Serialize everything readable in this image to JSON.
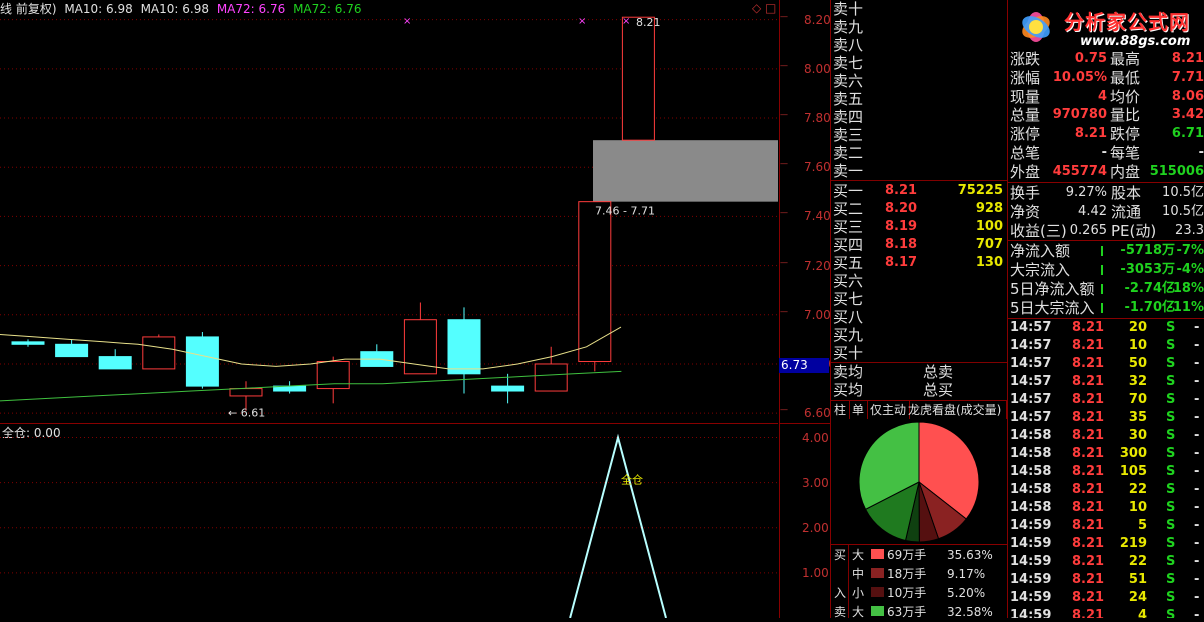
{
  "chart_header": {
    "title": "线 前复权)",
    "ma1": "MA10: 6.98",
    "ma2": "MA10: 6.98",
    "ma3": "MA72: 6.76",
    "ma4": "MA72: 6.76"
  },
  "colors": {
    "up": "#ff3c3c",
    "down": "#54ffff",
    "ma_short": "#e8e08a",
    "ma_long": "#3fc03f",
    "grid": "#800000"
  },
  "chart_data": [
    {
      "type": "candlestick",
      "y_ticks": [
        "8.20",
        "8.00",
        "7.80",
        "7.60",
        "7.40",
        "7.20",
        "7.00",
        "6.80",
        "6.60"
      ],
      "ylim": [
        6.56,
        8.28
      ],
      "candles": [
        {
          "o": 6.89,
          "h": 6.9,
          "l": 6.87,
          "c": 6.88
        },
        {
          "o": 6.88,
          "h": 6.9,
          "l": 6.83,
          "c": 6.83
        },
        {
          "o": 6.83,
          "h": 6.86,
          "l": 6.78,
          "c": 6.78
        },
        {
          "o": 6.78,
          "h": 6.92,
          "l": 6.78,
          "c": 6.91
        },
        {
          "o": 6.91,
          "h": 6.93,
          "l": 6.7,
          "c": 6.71
        },
        {
          "o": 6.67,
          "h": 6.73,
          "l": 6.61,
          "c": 6.7
        },
        {
          "o": 6.71,
          "h": 6.73,
          "l": 6.68,
          "c": 6.69
        },
        {
          "o": 6.7,
          "h": 6.83,
          "l": 6.64,
          "c": 6.81
        },
        {
          "o": 6.85,
          "h": 6.88,
          "l": 6.79,
          "c": 6.79
        },
        {
          "o": 6.76,
          "h": 7.05,
          "l": 6.76,
          "c": 6.98
        },
        {
          "o": 6.98,
          "h": 7.03,
          "l": 6.68,
          "c": 6.76
        },
        {
          "o": 6.71,
          "h": 6.76,
          "l": 6.64,
          "c": 6.69
        },
        {
          "o": 6.69,
          "h": 6.87,
          "l": 6.69,
          "c": 6.8
        },
        {
          "o": 6.81,
          "h": 6.87,
          "l": 6.77,
          "c": 7.46
        },
        {
          "o": 7.71,
          "h": 8.21,
          "l": 7.71,
          "c": 8.21
        }
      ],
      "ma10": [
        6.92,
        6.91,
        6.9,
        6.89,
        6.88,
        6.86,
        6.83,
        6.8,
        6.79,
        6.8,
        6.82,
        6.82,
        6.8,
        6.78,
        6.78,
        6.8,
        6.83,
        6.87,
        6.95
      ],
      "ma72": [
        6.65,
        6.66,
        6.67,
        6.68,
        6.69,
        6.7,
        6.71,
        6.72,
        6.72,
        6.73,
        6.74,
        6.75,
        6.76,
        6.77
      ],
      "annotations": {
        "low_label": "6.61",
        "high_label": "8.21",
        "gap_label": "7.46 - 7.71",
        "current_price": "6.73",
        "markers": [
          "×",
          "×",
          "×"
        ]
      }
    },
    {
      "type": "line",
      "title": "全仓: 0.00",
      "y_ticks": [
        "4.00",
        "3.00",
        "2.00",
        "1.00"
      ],
      "ylim": [
        0,
        4.3
      ],
      "x": [
        12.8,
        13.9,
        15.0
      ],
      "values": [
        0.0,
        4.0,
        0.0
      ],
      "annotation": "全仓"
    }
  ],
  "logo": {
    "title": "分析家公式网",
    "url": "www.88gs.com"
  },
  "sell_levels": [
    "卖十",
    "卖九",
    "卖八",
    "卖七",
    "卖六",
    "卖五",
    "卖四",
    "卖三",
    "卖二",
    "卖一"
  ],
  "buy_levels": [
    {
      "label": "买一",
      "price": "8.21",
      "vol": "75225"
    },
    {
      "label": "买二",
      "price": "8.20",
      "vol": "928"
    },
    {
      "label": "买三",
      "price": "8.19",
      "vol": "100"
    },
    {
      "label": "买四",
      "price": "8.18",
      "vol": "707"
    },
    {
      "label": "买五",
      "price": "8.17",
      "vol": "130"
    },
    {
      "label": "买六",
      "price": "",
      "vol": ""
    },
    {
      "label": "买七",
      "price": "",
      "vol": ""
    },
    {
      "label": "买八",
      "price": "",
      "vol": ""
    },
    {
      "label": "买九",
      "price": "",
      "vol": ""
    },
    {
      "label": "买十",
      "price": "",
      "vol": ""
    }
  ],
  "avg": {
    "sell_avg": "卖均",
    "sell_total": "总卖",
    "buy_avg": "买均",
    "buy_total": "总买"
  },
  "tabs": [
    "柱",
    "单",
    "仅主动",
    "龙虎看盘(成交量)历"
  ],
  "quote": [
    {
      "l1": "涨跌",
      "v1": "0.75",
      "l2": "最高",
      "v2": "8.21"
    },
    {
      "l1": "涨幅",
      "v1": "10.05%",
      "l2": "最低",
      "v2": "7.71"
    },
    {
      "l1": "现量",
      "v1": "4",
      "l2": "均价",
      "v2": "8.06"
    },
    {
      "l1": "总量",
      "v1": "970780",
      "l2": "量比",
      "v2": "3.42"
    },
    {
      "l1": "涨停",
      "v1": "8.21",
      "l2": "跌停",
      "v2": "6.71"
    },
    {
      "l1": "总笔",
      "v1": "-",
      "l2": "每笔",
      "v2": "-"
    },
    {
      "l1": "外盘",
      "v1": "455774",
      "l2": "内盘",
      "v2": "515006"
    }
  ],
  "finance": [
    {
      "l1": "换手",
      "v1": "9.27%",
      "l2": "股本",
      "v2": "10.5亿"
    },
    {
      "l1": "净资",
      "v1": "4.42",
      "l2": "流通",
      "v2": "10.5亿"
    },
    {
      "l1": "收益(三)",
      "v1": "0.265",
      "l2": "PE(动)",
      "v2": "23.3"
    }
  ],
  "flows": [
    {
      "label": "净流入额",
      "value": "-5718万",
      "pct": "-7%"
    },
    {
      "label": "大宗流入",
      "value": "-3053万",
      "pct": "-4%"
    },
    {
      "label": "5日净流入额",
      "value": "-2.74亿",
      "pct": "-18%"
    },
    {
      "label": "5日大宗流入",
      "value": "-1.70亿",
      "pct": "-11%"
    }
  ],
  "pie": {
    "slices": [
      {
        "name": "买大",
        "pct": 35.63,
        "color": "#ff5050"
      },
      {
        "name": "买中",
        "pct": 9.17,
        "color": "#8a2222"
      },
      {
        "name": "买小",
        "pct": 5.2,
        "color": "#551010"
      },
      {
        "name": "卖小",
        "pct": 3.7,
        "color": "#0f4010"
      },
      {
        "name": "卖中",
        "pct": 13.9,
        "color": "#1f7a1f"
      },
      {
        "name": "卖大",
        "pct": 32.58,
        "color": "#44c044"
      }
    ]
  },
  "pie_legend": [
    {
      "side": "买",
      "size": "大",
      "vol": "69万手",
      "pct": "35.63%",
      "color": "#ff5050"
    },
    {
      "side": "",
      "size": "中",
      "vol": "18万手",
      "pct": "9.17%",
      "color": "#8a2222"
    },
    {
      "side": "入",
      "size": "小",
      "vol": "10万手",
      "pct": "5.20%",
      "color": "#551010"
    },
    {
      "side": "卖",
      "size": "大",
      "vol": "63万手",
      "pct": "32.58%",
      "color": "#44c044"
    }
  ],
  "ticks": [
    {
      "time": "14:57",
      "price": "8.21",
      "vol": "20",
      "bs": "S",
      "sep": "-"
    },
    {
      "time": "14:57",
      "price": "8.21",
      "vol": "10",
      "bs": "S",
      "sep": "-"
    },
    {
      "time": "14:57",
      "price": "8.21",
      "vol": "50",
      "bs": "S",
      "sep": "-"
    },
    {
      "time": "14:57",
      "price": "8.21",
      "vol": "32",
      "bs": "S",
      "sep": "-"
    },
    {
      "time": "14:57",
      "price": "8.21",
      "vol": "70",
      "bs": "S",
      "sep": "-"
    },
    {
      "time": "14:57",
      "price": "8.21",
      "vol": "35",
      "bs": "S",
      "sep": "-"
    },
    {
      "time": "14:58",
      "price": "8.21",
      "vol": "30",
      "bs": "S",
      "sep": "-"
    },
    {
      "time": "14:58",
      "price": "8.21",
      "vol": "300",
      "bs": "S",
      "sep": "-"
    },
    {
      "time": "14:58",
      "price": "8.21",
      "vol": "105",
      "bs": "S",
      "sep": "-"
    },
    {
      "time": "14:58",
      "price": "8.21",
      "vol": "22",
      "bs": "S",
      "sep": "-"
    },
    {
      "time": "14:58",
      "price": "8.21",
      "vol": "10",
      "bs": "S",
      "sep": "-"
    },
    {
      "time": "14:59",
      "price": "8.21",
      "vol": "5",
      "bs": "S",
      "sep": "-"
    },
    {
      "time": "14:59",
      "price": "8.21",
      "vol": "219",
      "bs": "S",
      "sep": "-"
    },
    {
      "time": "14:59",
      "price": "8.21",
      "vol": "22",
      "bs": "S",
      "sep": "-"
    },
    {
      "time": "14:59",
      "price": "8.21",
      "vol": "51",
      "bs": "S",
      "sep": "-"
    },
    {
      "time": "14:59",
      "price": "8.21",
      "vol": "24",
      "bs": "S",
      "sep": "-"
    },
    {
      "time": "14:59",
      "price": "8.21",
      "vol": "4",
      "bs": "S",
      "sep": "-"
    }
  ],
  "icons": [
    "diamond-icon",
    "maximize-icon"
  ]
}
